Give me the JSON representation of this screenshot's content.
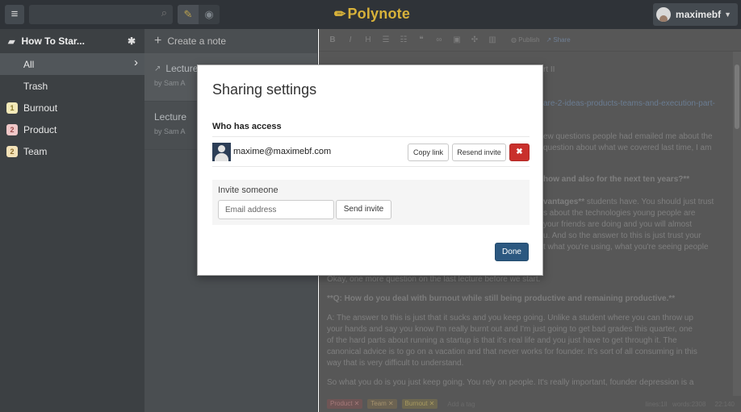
{
  "app": {
    "logo_text": "Polynote",
    "user_name": "maximebf"
  },
  "sidebar": {
    "notebook_name": "How To Star...",
    "items": [
      {
        "label": "All"
      },
      {
        "label": "Trash"
      }
    ],
    "tags": [
      {
        "count": "1",
        "label": "Burnout",
        "bg": "#f3e9b8",
        "fg": "#8a7a2a"
      },
      {
        "count": "2",
        "label": "Product",
        "bg": "#f0c8c8",
        "fg": "#9a4a4a"
      },
      {
        "count": "2",
        "label": "Team",
        "bg": "#f3e2b8",
        "fg": "#8a6a2a"
      }
    ]
  },
  "notelist": {
    "create_label": "Create a note",
    "notes": [
      {
        "title": "Lecture",
        "by": "by Sam A"
      },
      {
        "title": "Lecture",
        "by": "by Sam A"
      }
    ]
  },
  "editor": {
    "toolbar": {
      "publish_label": "Publish",
      "share_label": "Share"
    },
    "visible_fragments": {
      "title_tail": "rt II",
      "link_line": "are-2-ideas-products-teams-and-execution-part-",
      "p1_line1": "ew questions people had emailed me about the",
      "p1_line2": "question about what we covered last time, I am",
      "q1_tail": "how and also for the next ten years?**",
      "p2_line1_bold": "vantages**",
      "p2_line1_rest": " students have. You should just trust",
      "p2_line2": "s about the technologies young people are",
      "p2_line3": "your friends are doing and you will almost",
      "p2_line4": "u. And so the answer to this is just trust your",
      "p2_line5": "t what you're using, what you're seeing people"
    },
    "body": {
      "p_okay": "Okay, one more question on the last lecture before we start.",
      "q2": "**Q: How do you deal with burnout while still being productive and remaining productive.**",
      "a2_line1": "A: The answer to this is just that it sucks and you keep going. Unlike a student where you can throw up",
      "a2_line2": "your hands and say you know I'm really burnt out and I'm just going to get bad grades this quarter, one",
      "a2_line3": "of the hard parts about running a startup is that it's real life and you just have to get through it. The",
      "a2_line4": "canonical advice is to go on a vacation and that never works for founder. It's sort of all consuming in this",
      "a2_line5": "way that is very difficult to understand.",
      "p_last": "So what you do is you just keep going. You rely on people. It's really important, founder depression is a"
    },
    "footer": {
      "tags": [
        {
          "label": "Product",
          "bg": "#6f5555",
          "fg": "#a57a7a"
        },
        {
          "label": "Team",
          "bg": "#6c6352",
          "fg": "#a5926e"
        },
        {
          "label": "Burnout",
          "bg": "#6e6850",
          "fg": "#a89a60"
        }
      ],
      "add_tag_label": "Add a tag",
      "lines": "lines:1ll",
      "words": "words:2308",
      "pos": "22:140"
    }
  },
  "modal": {
    "title": "Sharing settings",
    "who_has_access": "Who has access",
    "user_email": "maxime@maximebf.com",
    "copy_link_label": "Copy link",
    "resend_invite_label": "Resend invite",
    "remove_label": "✖",
    "invite_label": "Invite someone",
    "email_placeholder": "Email address",
    "send_invite_label": "Send invite",
    "done_label": "Done"
  }
}
